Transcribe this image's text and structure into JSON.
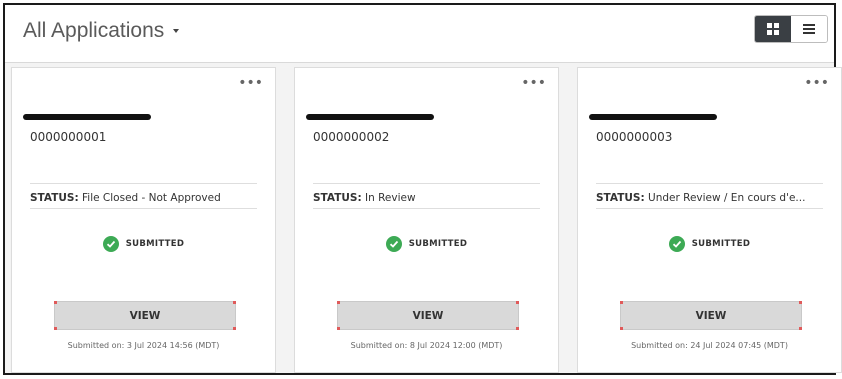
{
  "header": {
    "title": "All Applications",
    "grid_icon": "grid-view-icon",
    "list_icon": "list-view-icon"
  },
  "cards": [
    {
      "app_number": "0000000001",
      "status_label": "STATUS:",
      "status_value": "File Closed - Not Approved",
      "submitted_label": "SUBMITTED",
      "view_label": "VIEW",
      "submitted_on": "Submitted on: 3 Jul 2024 14:56 (MDT)"
    },
    {
      "app_number": "0000000002",
      "status_label": "STATUS:",
      "status_value": "In Review",
      "submitted_label": "SUBMITTED",
      "view_label": "VIEW",
      "submitted_on": "Submitted on: 8 Jul 2024 12:00 (MDT)"
    },
    {
      "app_number": "0000000003",
      "status_label": "STATUS:",
      "status_value": "Under Review / En cours d'e...",
      "submitted_label": "SUBMITTED",
      "view_label": "VIEW",
      "submitted_on": "Submitted on: 24 Jul 2024 07:45 (MDT)"
    }
  ],
  "colors": {
    "success": "#3daa55",
    "toggle_active": "#3a3f44",
    "button_bg": "#d9d9d9"
  }
}
